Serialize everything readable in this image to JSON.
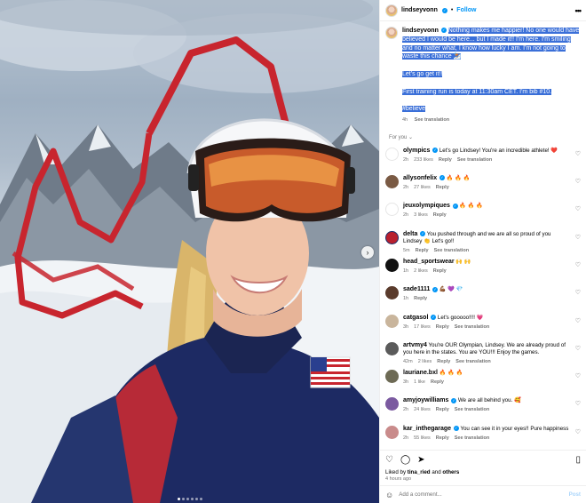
{
  "post": {
    "username": "lindseyvonn",
    "follow_label": "Follow",
    "dot": "•",
    "more": "•••",
    "caption_lines": [
      "Nothing makes me happier! No one would have",
      "believed I would be here... but I made it!! I'm here. I'm smiling",
      "and no matter what, I know how lucky I am. I'm not going to",
      "waste this chance ⛷️",
      "Let's go get it!!",
      "First training run is today at 11:30am CET. I'm bib #10.",
      "#believe"
    ],
    "caption_time": "4h",
    "see_translation": "See translation",
    "for_you": "For you",
    "image_next": "›"
  },
  "comments": [
    {
      "user": "olympics",
      "verified": true,
      "text": "Let's go Lindsey! You're an incredible athlete! ❤️",
      "time": "2h",
      "likes": "233 likes",
      "reply": "Reply",
      "translate": "See translation",
      "color": "#ffffff",
      "ring": "#e6e6e6"
    },
    {
      "user": "allysonfelix",
      "verified": true,
      "text": "🔥 🔥 🔥",
      "time": "2h",
      "likes": "27 likes",
      "reply": "Reply",
      "translate": "",
      "color": "#7a5a44",
      "ring": "#7a5a44"
    },
    {
      "user": "jeuxolympiques",
      "verified": true,
      "text": "🔥 🔥 🔥",
      "time": "2h",
      "likes": "3 likes",
      "reply": "Reply",
      "translate": "",
      "color": "#ffffff",
      "ring": "#e6e6e6"
    },
    {
      "user": "delta",
      "verified": true,
      "text": "You pushed through and we are all so proud of you Lindsey 👏 Let's go!!",
      "time": "5m",
      "likes": "",
      "reply": "Reply",
      "translate": "See translation",
      "color": "#b8202f",
      "ring": "#1b2f6b"
    },
    {
      "user": "head_sportswear",
      "verified": false,
      "text": "🙌 🙌",
      "time": "1h",
      "likes": "2 likes",
      "reply": "Reply",
      "translate": "",
      "color": "#111111",
      "ring": "#111111"
    },
    {
      "user": "sade1111",
      "verified": true,
      "text": "💪🏾 💜 💎",
      "time": "1h",
      "likes": "",
      "reply": "Reply",
      "translate": "",
      "color": "#5a3b2c",
      "ring": "#5a3b2c"
    },
    {
      "user": "catgasol",
      "verified": true,
      "text": "Let's gooooo!!!! 💗",
      "time": "3h",
      "likes": "17 likes",
      "reply": "Reply",
      "translate": "See translation",
      "color": "#c9b59c",
      "ring": "#c9b59c"
    },
    {
      "user": "artvmy4",
      "verified": false,
      "text": "You're OUR Olympian, Lindsey. We are already proud of you here in the states. You are YOU!!! Enjoy the games.",
      "time": "42m",
      "likes": "2 likes",
      "reply": "Reply",
      "translate": "See translation",
      "color": "#5b5b5b",
      "ring": "#5b5b5b"
    },
    {
      "user": "lauriane.bxl",
      "verified": false,
      "text": "🔥 🔥 🔥",
      "time": "3h",
      "likes": "1 like",
      "reply": "Reply",
      "translate": "",
      "color": "#6d6a55",
      "ring": "#6d6a55"
    },
    {
      "user": "amyjoywilliams",
      "verified": true,
      "text": "We are all behind you. 🥰",
      "time": "2h",
      "likes": "24 likes",
      "reply": "Reply",
      "translate": "See translation",
      "color": "#7b5aa0",
      "ring": "#7b5aa0"
    },
    {
      "user": "kar_inthegarage",
      "verified": true,
      "text": "You can see it in your eyes!! Pure happiness",
      "time": "2h",
      "likes": "55 likes",
      "reply": "Reply",
      "translate": "See translation",
      "color": "#c98b8b",
      "ring": "#c98b8b"
    }
  ],
  "footer": {
    "liked_by": "Liked by",
    "liked_user": "tina_ried",
    "and": "and",
    "others": "others",
    "time": "4 hours ago",
    "add_comment_placeholder": "Add a comment...",
    "post_label": "Post"
  },
  "icons": {
    "like": "♡",
    "comment": "💬",
    "share": "➤",
    "save": "🔖",
    "emoji": "☺",
    "heart_small": "♡",
    "verified": "✓"
  }
}
